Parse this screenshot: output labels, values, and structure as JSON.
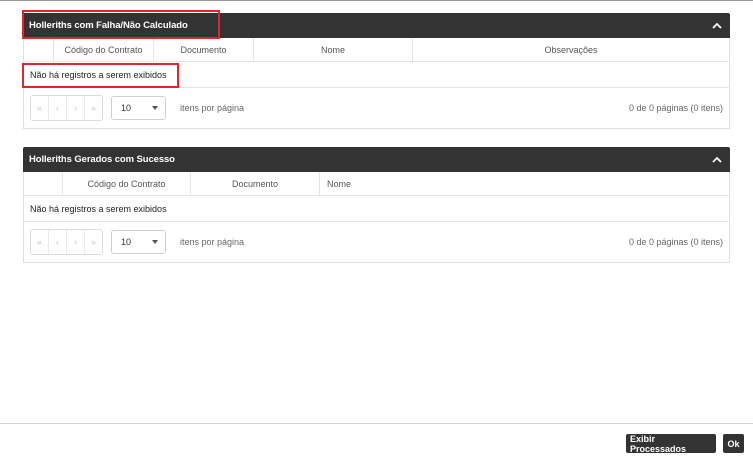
{
  "panel_failed": {
    "title": "Holleriths com Falha/Não Calculado",
    "columns": [
      "",
      "Código do Contrato",
      "Documento",
      "Nome",
      "Observações"
    ],
    "empty_message": "Não há registros a serem exibidos",
    "page_size": "10",
    "items_per_page_label": "itens por página",
    "page_info": "0 de 0 páginas (0 itens)",
    "pager_icons": [
      "first-page-icon",
      "previous-page-icon",
      "next-page-icon",
      "last-page-icon"
    ]
  },
  "panel_success": {
    "title": "Holleriths Gerados com Sucesso",
    "columns": [
      "",
      "Código do Contrato",
      "Documento",
      "Nome"
    ],
    "empty_message": "Não há registros a serem exibidos",
    "page_size": "10",
    "items_per_page_label": "itens por página",
    "page_info": "0 de 0 páginas (0 itens)"
  },
  "pager_glyphs": {
    "first": "«",
    "prev": "‹",
    "next": "›",
    "last": "»"
  },
  "footer": {
    "show_processed_label": "Exibir Processados",
    "ok_label": "Ok"
  },
  "colors": {
    "header_bg": "#333333",
    "highlight_border": "#e0262c"
  }
}
